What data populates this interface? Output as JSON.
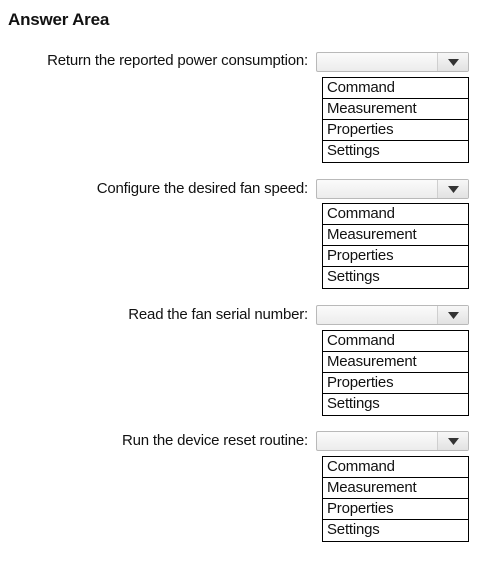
{
  "title": "Answer Area",
  "questions": [
    {
      "label": "Return the reported power consumption:",
      "selected": "",
      "options": [
        "Command",
        "Measurement",
        "Properties",
        "Settings"
      ]
    },
    {
      "label": "Configure the desired fan speed:",
      "selected": "",
      "options": [
        "Command",
        "Measurement",
        "Properties",
        "Settings"
      ]
    },
    {
      "label": "Read the fan serial number:",
      "selected": "",
      "options": [
        "Command",
        "Measurement",
        "Properties",
        "Settings"
      ]
    },
    {
      "label": "Run the device reset routine:",
      "selected": "",
      "options": [
        "Command",
        "Measurement",
        "Properties",
        "Settings"
      ]
    }
  ],
  "icons": {
    "dropdown_arrow": "chevron-down-icon"
  }
}
